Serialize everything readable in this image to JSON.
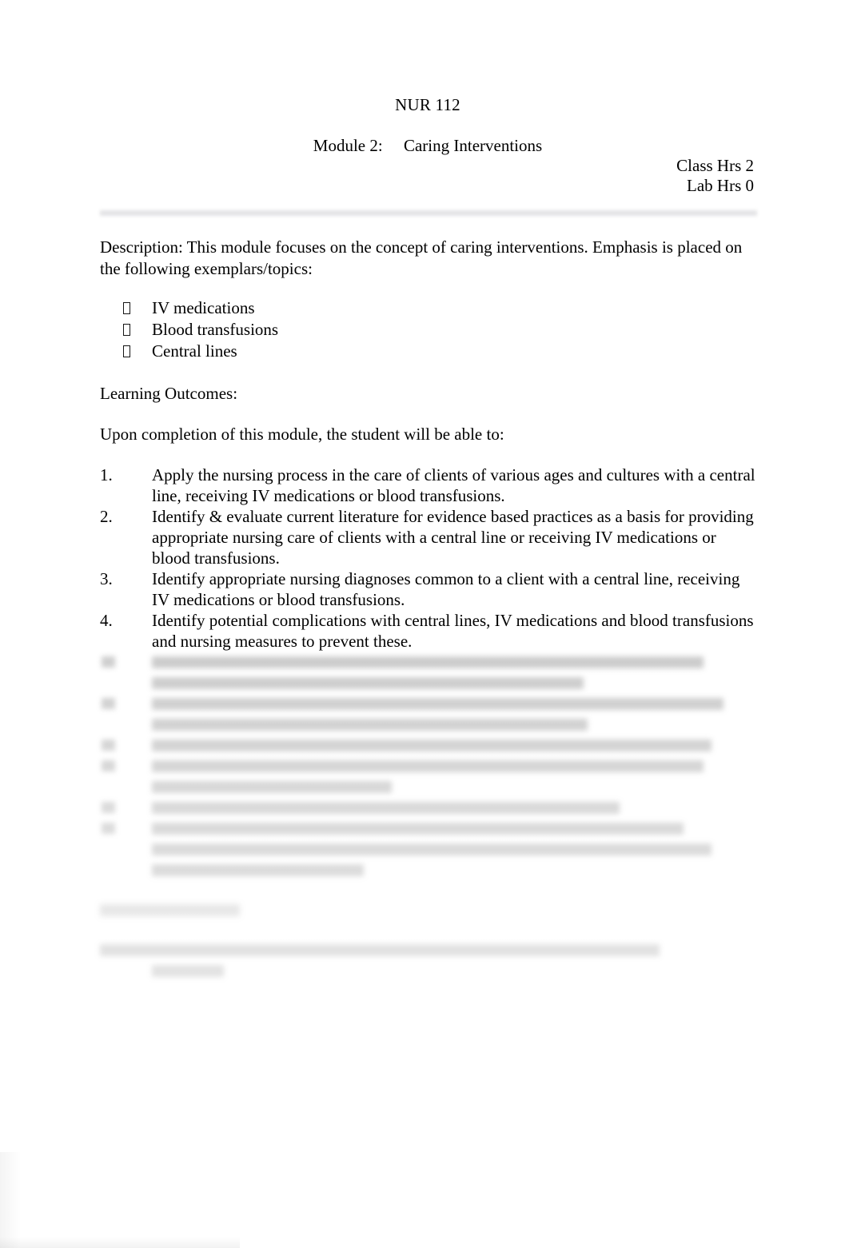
{
  "document": {
    "course_code": "NUR 112",
    "module_label": "Module 2:",
    "module_title": "Caring Interventions",
    "class_hours": "Class Hrs 2",
    "lab_hours": "Lab Hrs 0"
  },
  "description": {
    "text": "Description:  This module focuses on the concept of caring interventions.   Emphasis is placed on the following exemplars/topics:"
  },
  "exemplars": {
    "bullet_glyph": "tofu-box",
    "items": [
      "IV medications",
      "Blood transfusions",
      "Central lines"
    ]
  },
  "learning_outcomes": {
    "heading": "Learning Outcomes:",
    "intro": "Upon completion of this module, the student will be able to:",
    "items": [
      {
        "number": "1.",
        "text": "Apply the nursing process in the care of clients of various ages and cultures with a central line, receiving IV medications or blood transfusions."
      },
      {
        "number": "2.",
        "text": "Identify & evaluate current literature for evidence based practices as a basis for providing appropriate nursing care of clients with a central line or receiving IV medications or blood transfusions."
      },
      {
        "number": "3.",
        "text": "Identify appropriate nursing diagnoses common to a client with a central line, receiving IV medications or blood transfusions."
      },
      {
        "number": "4.",
        "text": "Identify potential complications with central lines, IV medications and blood transfusions and nursing measures to prevent these."
      }
    ],
    "obscured_items": [
      {
        "line_widths": [
          690,
          540
        ]
      },
      {
        "line_widths": [
          715,
          545
        ]
      },
      {
        "line_widths": [
          700
        ]
      },
      {
        "line_widths": [
          690,
          300
        ]
      },
      {
        "line_widths": [
          585
        ]
      },
      {
        "line_widths": [
          665,
          700,
          265
        ]
      }
    ]
  },
  "obscured_sections": {
    "heading_width": 175,
    "reference_line_widths": [
      700,
      90
    ]
  }
}
